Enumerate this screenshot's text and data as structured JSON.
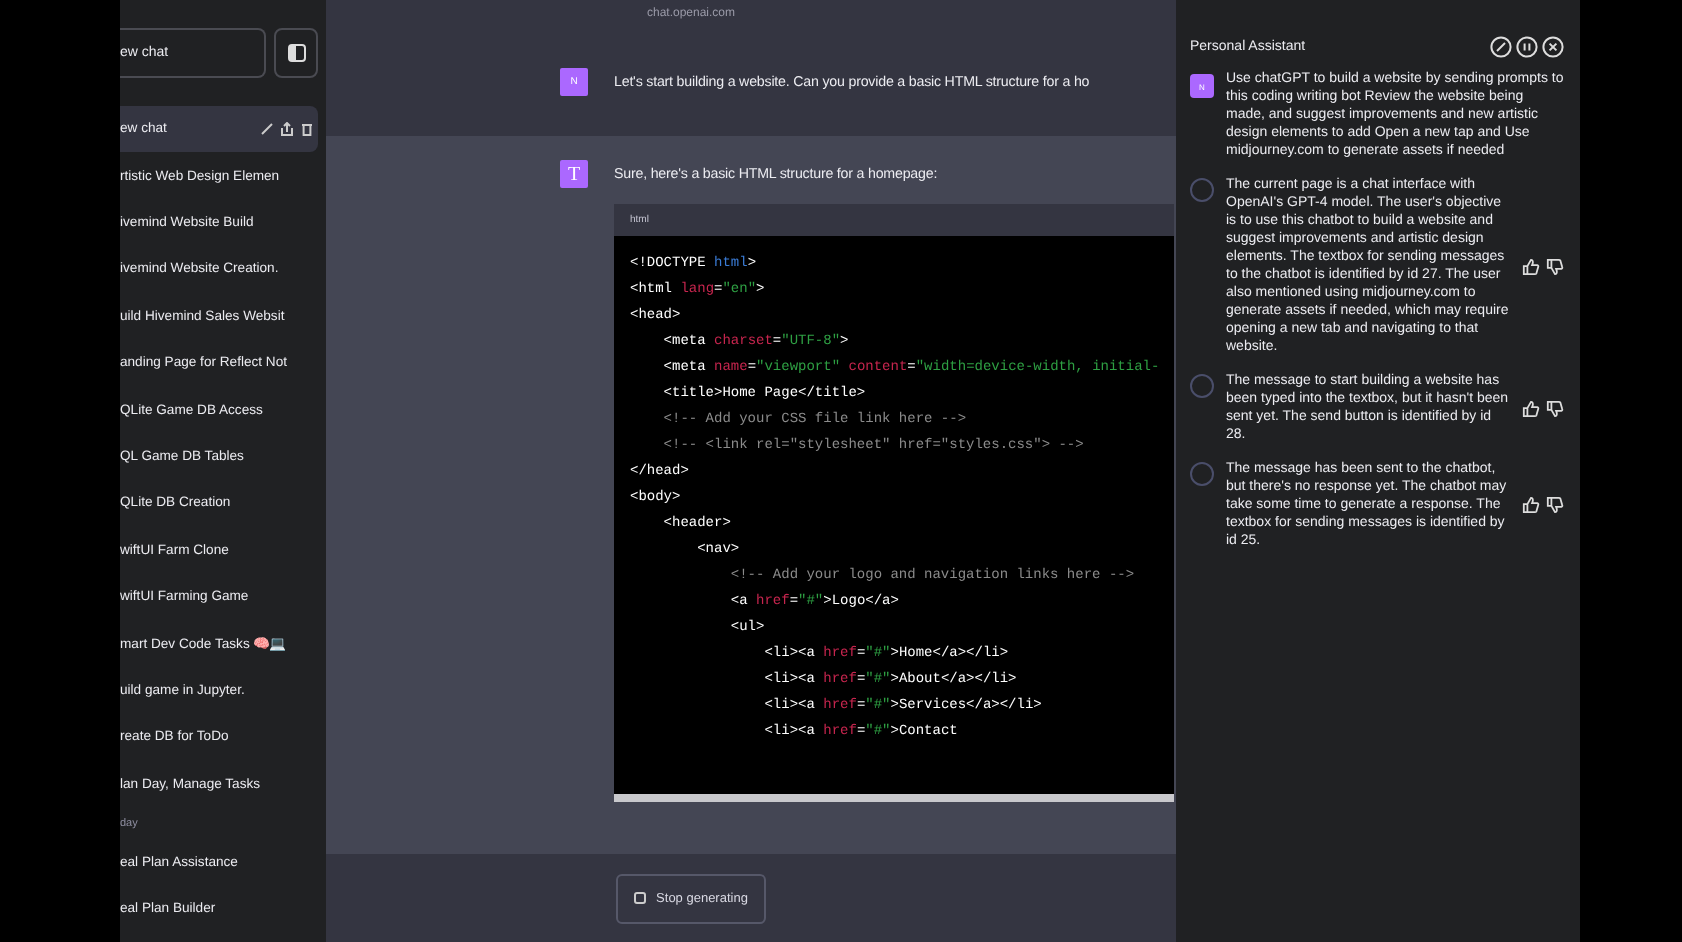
{
  "address_bar": {
    "url": "chat.openai.com"
  },
  "sidebar": {
    "new_chat_button": "ew chat",
    "items": [
      {
        "label": "ew chat",
        "selected": true
      },
      {
        "label": "rtistic Web Design Elemen",
        "selected": false
      },
      {
        "label": "ivemind Website Build",
        "selected": false
      },
      {
        "label": "ivemind Website Creation.",
        "selected": false
      },
      {
        "label": "uild Hivemind Sales Websit",
        "selected": false
      },
      {
        "label": "anding Page for Reflect Not",
        "selected": false
      },
      {
        "label": "QLite Game DB Access",
        "selected": false
      },
      {
        "label": "QL Game DB Tables",
        "selected": false
      },
      {
        "label": "QLite DB Creation",
        "selected": false
      },
      {
        "label": "wiftUI Farm Clone",
        "selected": false
      },
      {
        "label": "wiftUI Farming Game",
        "selected": false
      },
      {
        "label": "mart Dev Code Tasks 🧠💻",
        "selected": false
      },
      {
        "label": "uild game in Jupyter.",
        "selected": false
      },
      {
        "label": "reate DB for ToDo",
        "selected": false
      },
      {
        "label": "lan Day, Manage Tasks",
        "selected": false
      },
      {
        "kind": "section",
        "label": "day"
      },
      {
        "label": "eal Plan Assistance",
        "selected": false
      },
      {
        "label": "eal Plan Builder",
        "selected": false
      }
    ]
  },
  "conversation": [
    {
      "kind": "user",
      "avatar": "N",
      "text": "Let's start building a website. Can you provide a basic HTML structure for a ho"
    },
    {
      "kind": "assistant",
      "avatar": "T",
      "text": "Sure, here's a basic HTML structure for a homepage:",
      "code_block": {
        "language": "html",
        "lines": [
          [
            {
              "kind": "text",
              "text": "<!DOCTYPE "
            },
            {
              "kind": "kw",
              "text": "html"
            },
            {
              "kind": "text",
              "text": ">"
            }
          ],
          [
            {
              "kind": "text",
              "text": "<html "
            },
            {
              "kind": "attr",
              "text": "lang"
            },
            {
              "kind": "text",
              "text": "="
            },
            {
              "kind": "str",
              "text": "\"en\""
            },
            {
              "kind": "text",
              "text": ">"
            }
          ],
          [
            {
              "kind": "text",
              "text": "<head>"
            }
          ],
          [
            {
              "kind": "text",
              "text": "    <meta "
            },
            {
              "kind": "attr",
              "text": "charset"
            },
            {
              "kind": "text",
              "text": "="
            },
            {
              "kind": "str",
              "text": "\"UTF-8\""
            },
            {
              "kind": "text",
              "text": ">"
            }
          ],
          [
            {
              "kind": "text",
              "text": "    <meta "
            },
            {
              "kind": "attr",
              "text": "name"
            },
            {
              "kind": "text",
              "text": "="
            },
            {
              "kind": "str",
              "text": "\"viewport\" "
            },
            {
              "kind": "attr",
              "text": "content"
            },
            {
              "kind": "text",
              "text": "="
            },
            {
              "kind": "str",
              "text": "\"width=device-width, initial-"
            }
          ],
          [
            {
              "kind": "text",
              "text": "    <title>Home Page</title>"
            }
          ],
          [
            {
              "kind": "comment",
              "text": "    <!-- Add your CSS file link here -->"
            }
          ],
          [
            {
              "kind": "comment",
              "text": "    <!-- <link rel=\"stylesheet\" href=\"styles.css\"> -->"
            }
          ],
          [
            {
              "kind": "text",
              "text": "</head>"
            }
          ],
          [
            {
              "kind": "text",
              "text": "<body>"
            }
          ],
          [
            {
              "kind": "text",
              "text": "    <header>"
            }
          ],
          [
            {
              "kind": "text",
              "text": "        <nav>"
            }
          ],
          [
            {
              "kind": "comment",
              "text": "            <!-- Add your logo and navigation links here -->"
            }
          ],
          [
            {
              "kind": "text",
              "text": "            <a "
            },
            {
              "kind": "attr",
              "text": "href"
            },
            {
              "kind": "text",
              "text": "="
            },
            {
              "kind": "str",
              "text": "\"#\""
            },
            {
              "kind": "text",
              "text": ">Logo</a>"
            }
          ],
          [
            {
              "kind": "text",
              "text": "            <ul>"
            }
          ],
          [
            {
              "kind": "text",
              "text": "                <li><a "
            },
            {
              "kind": "attr",
              "text": "href"
            },
            {
              "kind": "text",
              "text": "="
            },
            {
              "kind": "str",
              "text": "\"#\""
            },
            {
              "kind": "text",
              "text": ">Home</a></li>"
            }
          ],
          [
            {
              "kind": "text",
              "text": "                <li><a "
            },
            {
              "kind": "attr",
              "text": "href"
            },
            {
              "kind": "text",
              "text": "="
            },
            {
              "kind": "str",
              "text": "\"#\""
            },
            {
              "kind": "text",
              "text": ">About</a></li>"
            }
          ],
          [
            {
              "kind": "text",
              "text": "                <li><a "
            },
            {
              "kind": "attr",
              "text": "href"
            },
            {
              "kind": "text",
              "text": "="
            },
            {
              "kind": "str",
              "text": "\"#\""
            },
            {
              "kind": "text",
              "text": ">Services</a></li>"
            }
          ],
          [
            {
              "kind": "text",
              "text": "                <li><a "
            },
            {
              "kind": "attr",
              "text": "href"
            },
            {
              "kind": "text",
              "text": "="
            },
            {
              "kind": "str",
              "text": "\"#\""
            },
            {
              "kind": "text",
              "text": ">Contact"
            }
          ]
        ]
      }
    }
  ],
  "stop_button": "Stop generating",
  "assistant_panel": {
    "title": "Personal Assistant",
    "messages": [
      {
        "kind": "goal",
        "avatar": "N",
        "text": "Use chatGPT to build a website by sending prompts to this coding writing bot Review the website being made, and suggest improvements and new artistic design elements to add Open a new tap and Use midjourney.com to generate assets if needed"
      },
      {
        "kind": "thought",
        "text": "The current page is a chat interface with OpenAI's GPT-4 model. The user's objective is to use this chatbot to build a website and suggest improvements and artistic design elements. The textbox for sending messages to the chatbot is identified by id 27. The user also mentioned using midjourney.com to generate assets if needed, which may require opening a new tab and navigating to that website."
      },
      {
        "kind": "thought",
        "text": "The message to start building a website has been typed into the textbox, but it hasn't been sent yet. The send button is identified by id 28."
      },
      {
        "kind": "thought",
        "text": "The message has been sent to the chatbot, but there's no response yet. The chatbot may take some time to generate a response. The textbox for sending messages is identified by id 25."
      }
    ]
  }
}
